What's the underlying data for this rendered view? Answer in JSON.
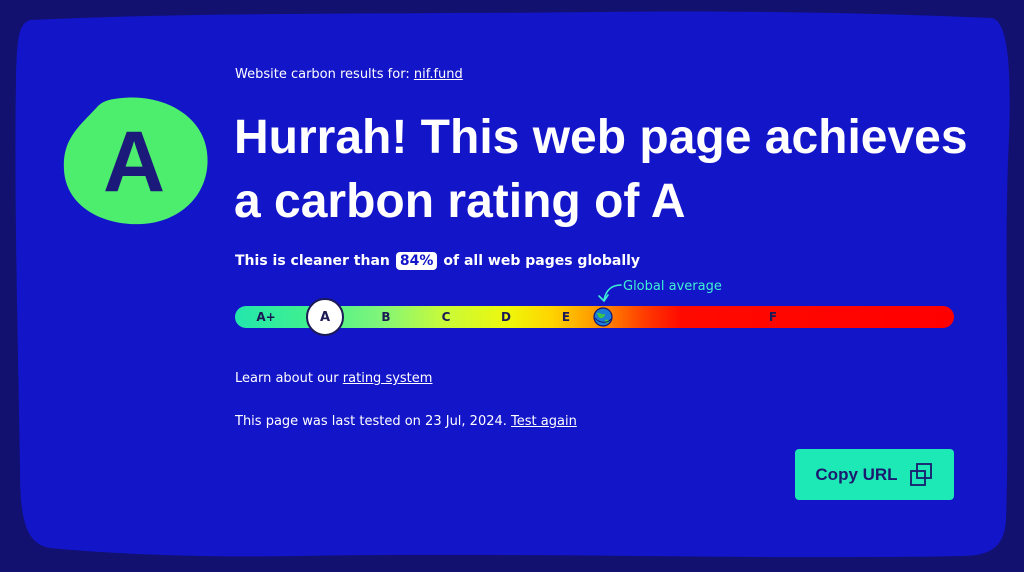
{
  "colors": {
    "background": "#121170",
    "panel": "#1315c9",
    "blob": "#4dee6e",
    "accent": "#1de9b6",
    "global_average": "#3ff0d4"
  },
  "rating": {
    "letter": "A"
  },
  "intro": {
    "label": "Website carbon results for:",
    "site": "nif.fund"
  },
  "headline": "Hurrah! This web page achieves a carbon rating of A",
  "cleaner": {
    "before": "This is cleaner than",
    "percent": "84%",
    "after": "of all web pages globally"
  },
  "scale": {
    "grades": [
      "A+",
      "A",
      "B",
      "C",
      "D",
      "E",
      "F"
    ],
    "current": "A",
    "global_average_label": "Global average",
    "global_average_icon": "globe-icon"
  },
  "learn": {
    "text": "Learn about our",
    "link": "rating system"
  },
  "tested": {
    "text": "This page was last tested on 23 Jul, 2024.",
    "link": "Test again"
  },
  "copy": {
    "label": "Copy URL",
    "icon": "copy-icon"
  }
}
